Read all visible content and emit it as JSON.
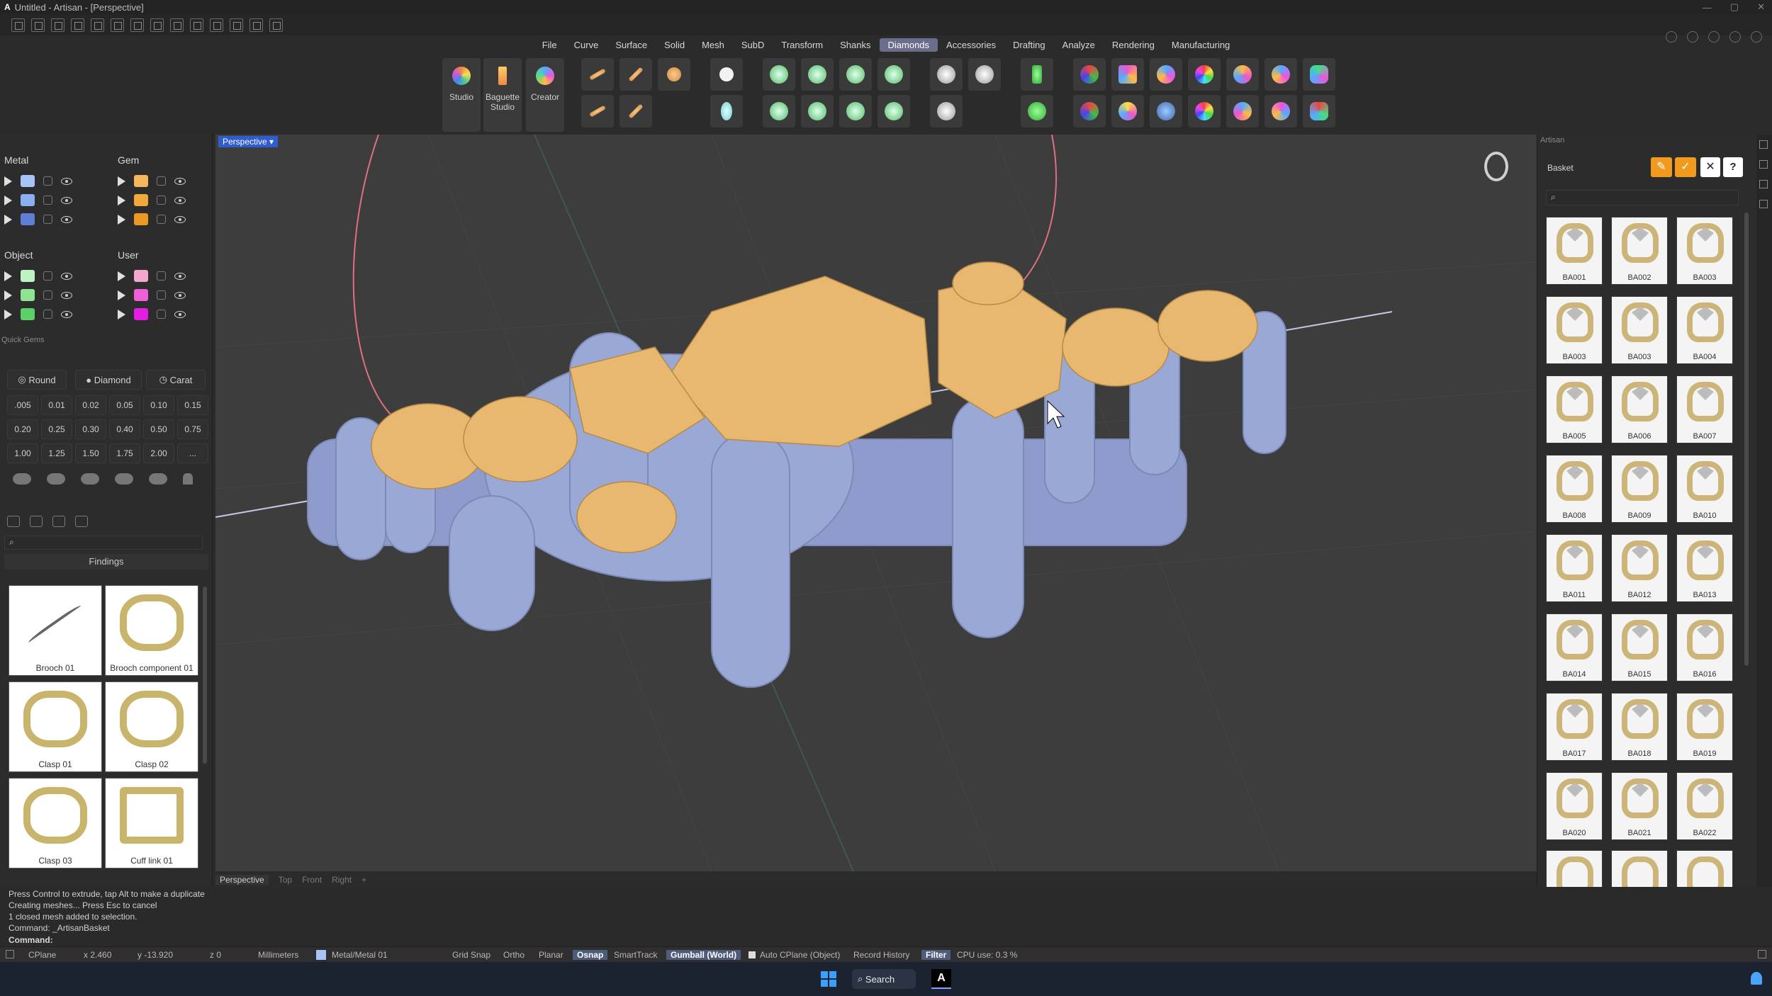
{
  "window": {
    "title": "Untitled - Artisan - [Perspective]",
    "logo": "A"
  },
  "menu": [
    {
      "label": "File"
    },
    {
      "label": "Curve"
    },
    {
      "label": "Surface"
    },
    {
      "label": "Solid"
    },
    {
      "label": "Mesh"
    },
    {
      "label": "SubD"
    },
    {
      "label": "Transform"
    },
    {
      "label": "Shanks"
    },
    {
      "label": "Diamonds",
      "active": true
    },
    {
      "label": "Accessories"
    },
    {
      "label": "Drafting"
    },
    {
      "label": "Analyze"
    },
    {
      "label": "Rendering"
    },
    {
      "label": "Manufacturing"
    }
  ],
  "toolbar": {
    "studio": "Studio",
    "baguette": "Baguette Studio",
    "creator": "Creator"
  },
  "layers": {
    "metal": {
      "title": "Metal",
      "colors": [
        "#a8c3f5",
        "#8aaef0",
        "#5f7fd6"
      ]
    },
    "gem": {
      "title": "Gem",
      "colors": [
        "#f5b55e",
        "#f0a73c",
        "#ea9a23"
      ]
    },
    "object": {
      "title": "Object",
      "colors": [
        "#bff2c2",
        "#8fe393",
        "#5ccf66"
      ]
    },
    "user": {
      "title": "User",
      "colors": [
        "#f5a6cf",
        "#ee5fd8",
        "#e31ee0"
      ]
    }
  },
  "quick_gems": {
    "title": "Quick Gems",
    "shape": "Round",
    "material": "Diamond",
    "unit": "Carat",
    "sizes": [
      ".005",
      "0.01",
      "0.02",
      "0.05",
      "0.10",
      "0.15",
      "0.20",
      "0.25",
      "0.30",
      "0.40",
      "0.50",
      "0.75",
      "1.00",
      "1.25",
      "1.50",
      "1.75",
      "2.00",
      "..."
    ]
  },
  "findings": {
    "title": "Findings",
    "items": [
      {
        "label": "Brooch 01"
      },
      {
        "label": "Brooch component 01"
      },
      {
        "label": "Clasp 01"
      },
      {
        "label": "Clasp 02"
      },
      {
        "label": "Clasp 03"
      },
      {
        "label": "Cuff link 01"
      }
    ]
  },
  "viewport": {
    "label": "Perspective",
    "tabs": [
      "Perspective",
      "Top",
      "Front",
      "Right"
    ],
    "add": "+"
  },
  "artisan": {
    "panel_title": "Artisan",
    "basket_title": "Basket",
    "help": "?",
    "items": [
      "BA001",
      "BA002",
      "BA003",
      "BA003",
      "BA003",
      "BA004",
      "BA005",
      "BA006",
      "BA007",
      "BA008",
      "BA009",
      "BA010",
      "BA011",
      "BA012",
      "BA013",
      "BA014",
      "BA015",
      "BA016",
      "BA017",
      "BA018",
      "BA019",
      "BA020",
      "BA021",
      "BA022"
    ]
  },
  "command_log": [
    "Press Control to extrude, tap Alt to make a duplicate",
    "Creating meshes... Press Esc to cancel",
    "1 closed mesh added to selection.",
    "Command: _ArtisanBasket"
  ],
  "command_prompt": "Command:",
  "status": {
    "cplane": "CPlane",
    "x": "x 2.460",
    "y": "y -13.920",
    "z": "z 0",
    "units": "Millimeters",
    "layer": "Metal/Metal 01",
    "grid_snap": "Grid Snap",
    "ortho": "Ortho",
    "planar": "Planar",
    "osnap": "Osnap",
    "smarttrack": "SmartTrack",
    "gumball": "Gumball (World)",
    "auto_cplane": "Auto CPlane (Object)",
    "record_history": "Record History",
    "filter": "Filter",
    "cpu": "CPU use: 0.3 %"
  },
  "taskbar": {
    "search": "Search",
    "app_glyph": "A"
  },
  "colors": {
    "metal": "#9aa8d6",
    "gem": "#e8b870",
    "accent_orange": "#f29a1e",
    "active_tab": "#6b6d8c"
  }
}
